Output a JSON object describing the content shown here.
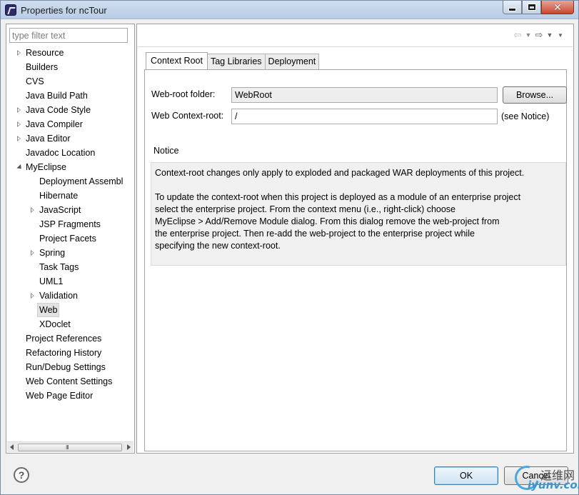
{
  "window": {
    "title": "Properties for ncTour"
  },
  "left": {
    "filter_placeholder": "type filter text",
    "tree": [
      {
        "label": "Resource",
        "twisty": "closed",
        "level": 0
      },
      {
        "label": "Builders",
        "twisty": "none",
        "level": 0
      },
      {
        "label": "CVS",
        "twisty": "none",
        "level": 0
      },
      {
        "label": "Java Build Path",
        "twisty": "none",
        "level": 0
      },
      {
        "label": "Java Code Style",
        "twisty": "closed",
        "level": 0
      },
      {
        "label": "Java Compiler",
        "twisty": "closed",
        "level": 0
      },
      {
        "label": "Java Editor",
        "twisty": "closed",
        "level": 0
      },
      {
        "label": "Javadoc Location",
        "twisty": "none",
        "level": 0
      },
      {
        "label": "MyEclipse",
        "twisty": "open",
        "level": 0
      },
      {
        "label": "Deployment Assembl",
        "twisty": "none",
        "level": 1
      },
      {
        "label": "Hibernate",
        "twisty": "none",
        "level": 1
      },
      {
        "label": "JavaScript",
        "twisty": "closed",
        "level": 1
      },
      {
        "label": "JSP Fragments",
        "twisty": "none",
        "level": 1
      },
      {
        "label": "Project Facets",
        "twisty": "none",
        "level": 1
      },
      {
        "label": "Spring",
        "twisty": "closed",
        "level": 1
      },
      {
        "label": "Task Tags",
        "twisty": "none",
        "level": 1
      },
      {
        "label": "UML1",
        "twisty": "none",
        "level": 1
      },
      {
        "label": "Validation",
        "twisty": "closed",
        "level": 1
      },
      {
        "label": "Web",
        "twisty": "none",
        "level": 1,
        "selected": true
      },
      {
        "label": "XDoclet",
        "twisty": "none",
        "level": 1
      },
      {
        "label": "Project References",
        "twisty": "none",
        "level": 0
      },
      {
        "label": "Refactoring History",
        "twisty": "none",
        "level": 0
      },
      {
        "label": "Run/Debug Settings",
        "twisty": "none",
        "level": 0
      },
      {
        "label": "Web Content Settings",
        "twisty": "none",
        "level": 0
      },
      {
        "label": "Web Page Editor",
        "twisty": "none",
        "level": 0
      }
    ],
    "scroll_grip": "III"
  },
  "right": {
    "tabs": [
      "Context Root",
      "Tag Libraries",
      "Deployment"
    ],
    "active_tab": 0,
    "web_root_label": "Web-root folder:",
    "web_root_value": "WebRoot",
    "browse_label": "Browse...",
    "context_root_label": "Web Context-root:",
    "context_root_value": "/",
    "see_notice": "(see Notice)",
    "notice_title": "Notice",
    "notice_lines": [
      "Context-root changes only apply to exploded and packaged WAR deployments of this project.",
      "",
      "To update the context-root when this project is deployed as a module of an enterprise project",
      "select the enterprise project. From the context menu (i.e., right-click) choose",
      "MyEclipse > Add/Remove Module dialog. From this dialog remove the web-project from",
      "the enterprise project. Then re-add the web-project to the enterprise project while",
      "specifying the new context-root."
    ]
  },
  "footer": {
    "help_label": "?",
    "ok_label": "OK",
    "cancel_label": "Cancel"
  },
  "watermark": {
    "line1": "运维网",
    "line2": "iyunv.com"
  }
}
